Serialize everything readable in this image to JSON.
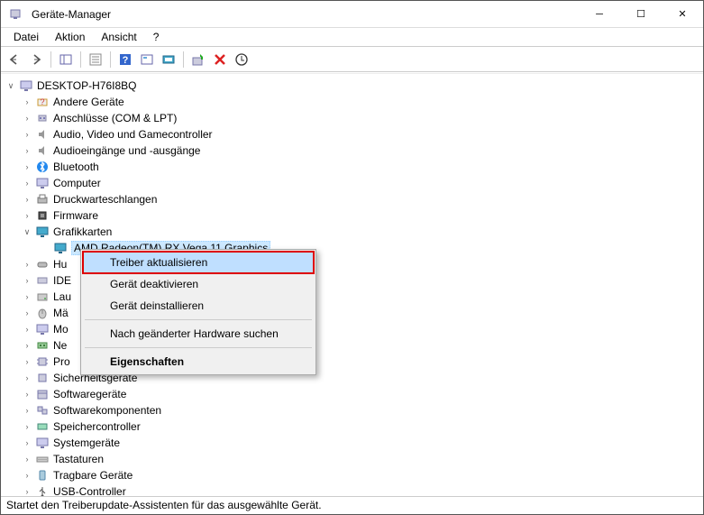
{
  "window": {
    "title": "Geräte-Manager"
  },
  "menu": {
    "file": "Datei",
    "action": "Aktion",
    "view": "Ansicht",
    "help": "?"
  },
  "tree": {
    "root": "DESKTOP-H76I8BQ",
    "categories": {
      "andere": "Andere Geräte",
      "anschluesse": "Anschlüsse (COM & LPT)",
      "audio": "Audio, Video und Gamecontroller",
      "audioein": "Audioeingänge und -ausgänge",
      "bluetooth": "Bluetooth",
      "computer": "Computer",
      "druck": "Druckwarteschlangen",
      "firmware": "Firmware",
      "grafik": "Grafikkarten",
      "human": "Hu",
      "ide": "IDE",
      "lau": "Lau",
      "ma": "Mä",
      "mo": "Mo",
      "ne": "Ne",
      "pro": "Pro",
      "sicherheit": "Sicherheitsgeräte",
      "software": "Softwaregeräte",
      "softwarekomp": "Softwarekomponenten",
      "speicher": "Speichercontroller",
      "system": "Systemgeräte",
      "tast": "Tastaturen",
      "tragbar": "Tragbare Geräte",
      "usb": "USB-Controller"
    },
    "selected_device": "AMD Radeon(TM) RX Vega 11 Graphics"
  },
  "context_menu": {
    "update": "Treiber aktualisieren",
    "disable": "Gerät deaktivieren",
    "uninstall": "Gerät deinstallieren",
    "scan": "Nach geänderter Hardware suchen",
    "properties": "Eigenschaften"
  },
  "status": "Startet den Treiberupdate-Assistenten für das ausgewählte Gerät."
}
